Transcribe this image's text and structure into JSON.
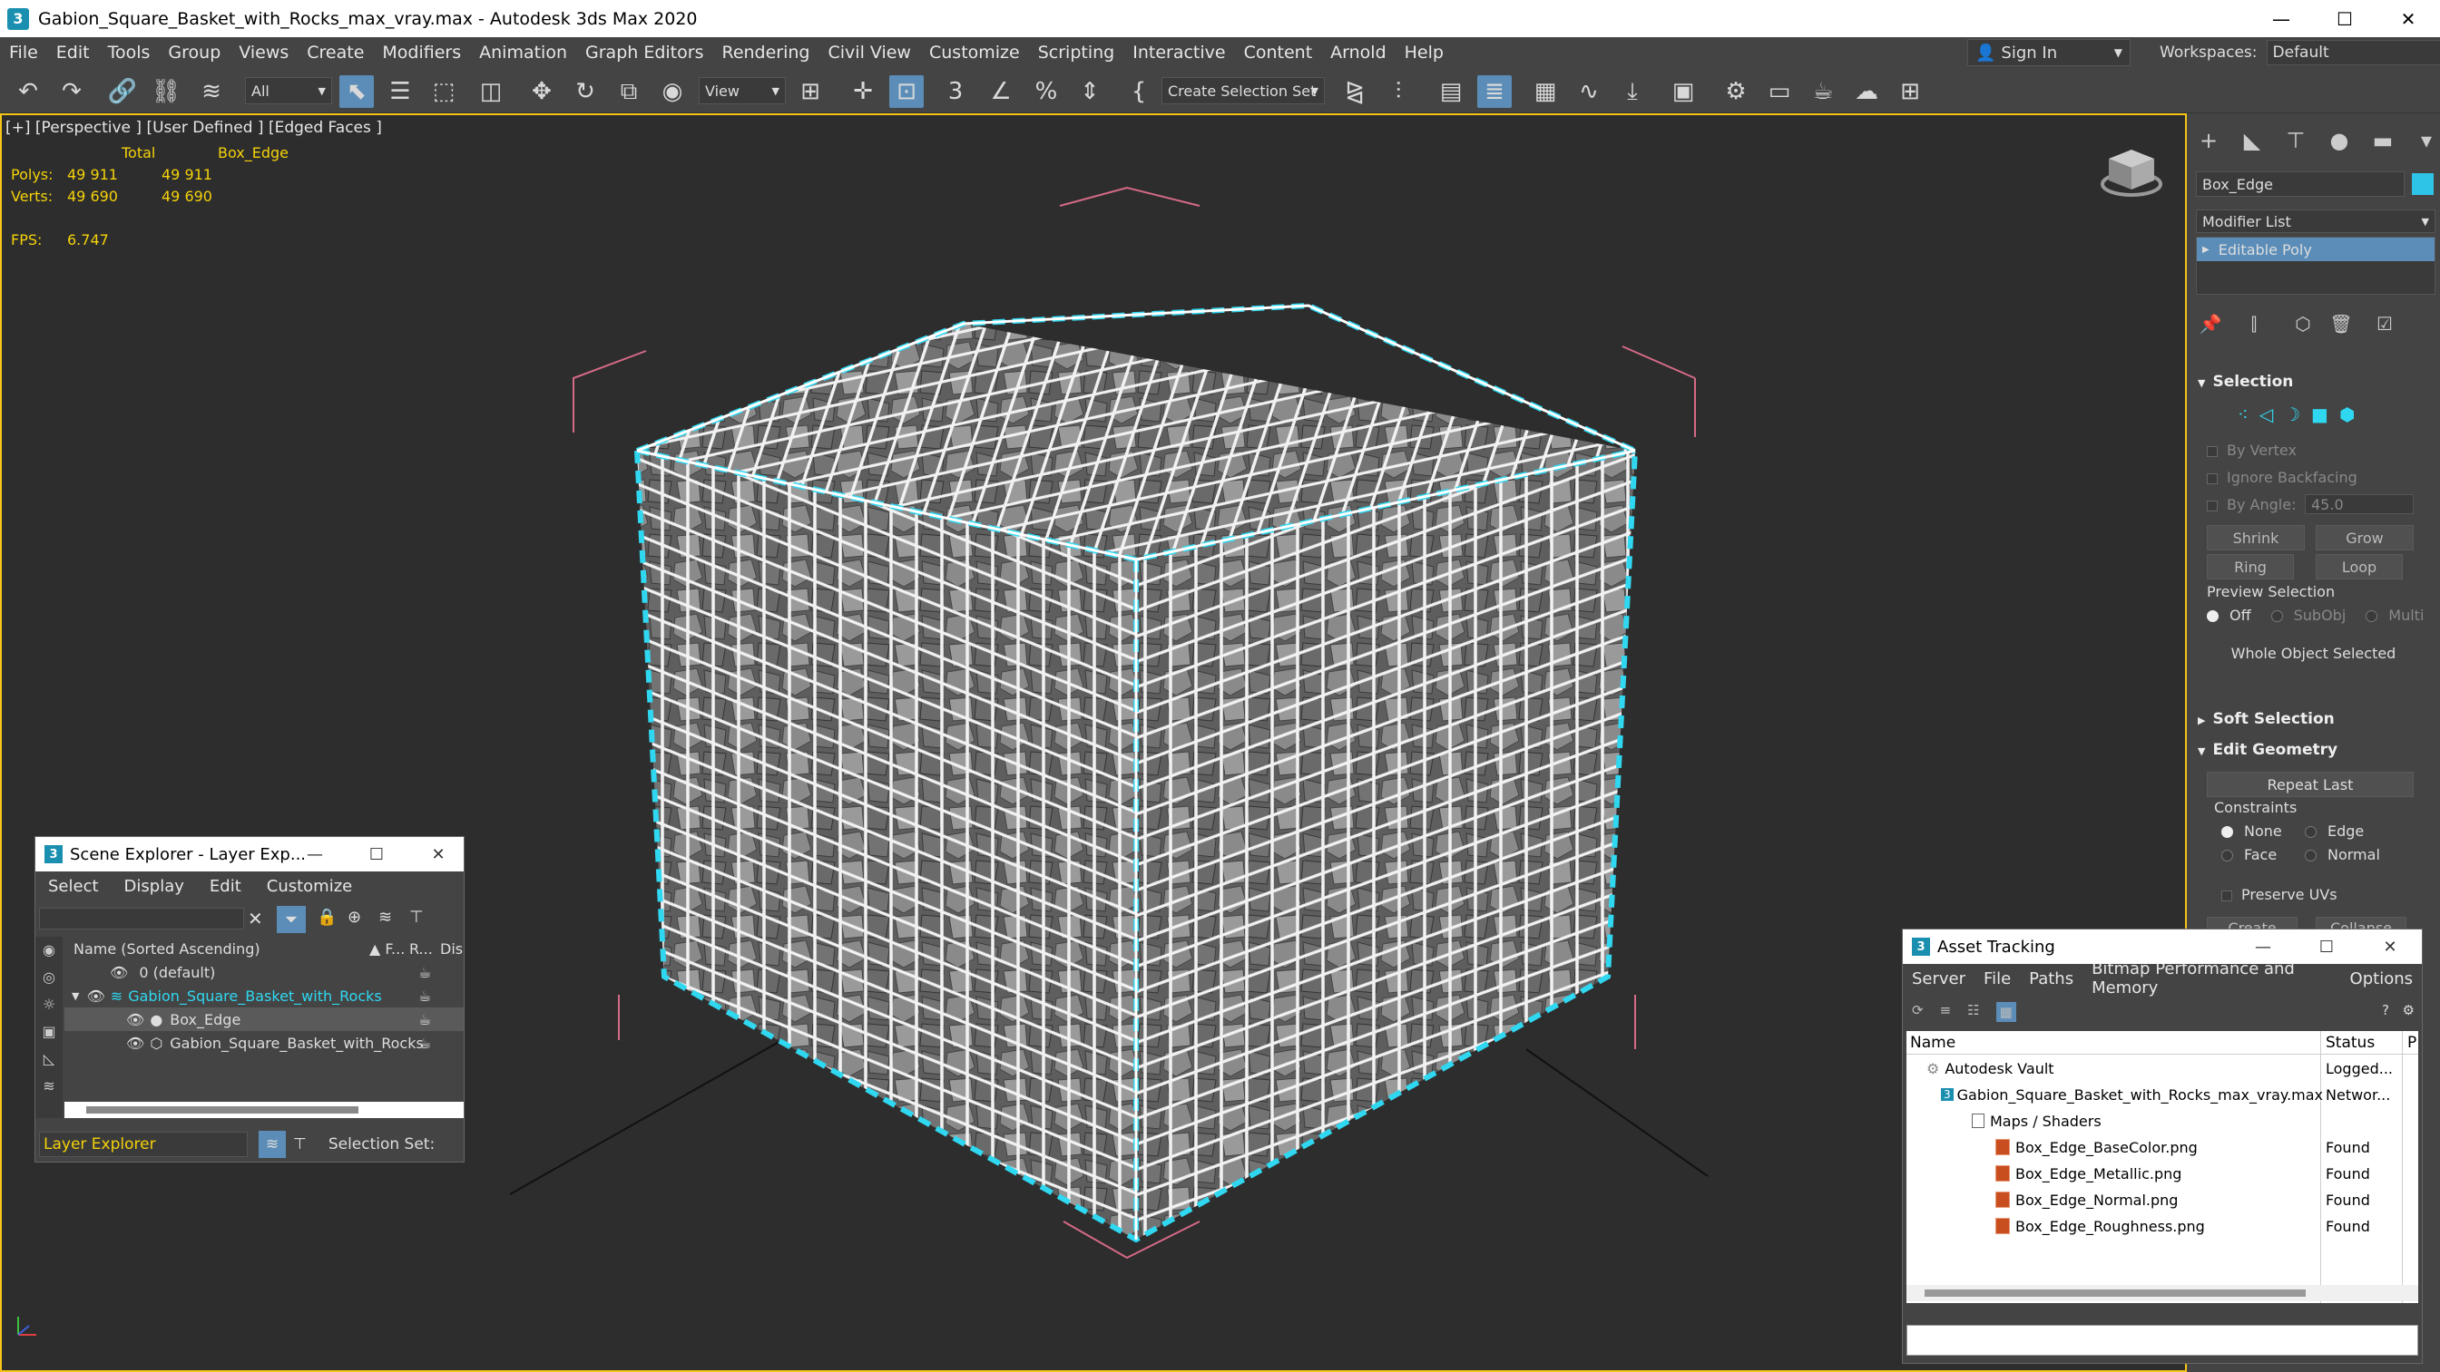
{
  "titlebar": {
    "title": "Gabion_Square_Basket_with_Rocks_max_vray.max - Autodesk 3ds Max 2020",
    "logo": "3",
    "minimize": "—",
    "maximize": "☐",
    "close": "✕"
  },
  "menu": [
    "File",
    "Edit",
    "Tools",
    "Group",
    "Views",
    "Create",
    "Modifiers",
    "Animation",
    "Graph Editors",
    "Rendering",
    "Civil View",
    "Customize",
    "Scripting",
    "Interactive",
    "Content",
    "Arnold",
    "Help"
  ],
  "signin": {
    "label": "Sign In"
  },
  "workspaces": {
    "label": "Workspaces:",
    "value": "Default"
  },
  "toolbar": {
    "filter_value": "All",
    "view_value": "View",
    "selection_set_placeholder": "Create Selection Set",
    "snap_number": "3"
  },
  "viewport": {
    "label": "[+] [Perspective ] [User Defined ] [Edged Faces ]",
    "stats": {
      "col_total": "Total",
      "col_object": "Box_Edge",
      "polys_label": "Polys:",
      "polys_total": "49 911",
      "polys_object": "49 911",
      "verts_label": "Verts:",
      "verts_total": "49 690",
      "verts_object": "49 690"
    },
    "fps_label": "FPS:",
    "fps_value": "6.747"
  },
  "command_panel": {
    "object_name": "Box_Edge",
    "object_color": "#2ec4e8",
    "modifier_list": "Modifier List",
    "stack_item": "Editable Poly",
    "selection": {
      "title": "Selection",
      "by_vertex": "By Vertex",
      "ignore_backfacing": "Ignore Backfacing",
      "by_angle": "By Angle:",
      "angle_value": "45.0",
      "shrink": "Shrink",
      "grow": "Grow",
      "ring": "Ring",
      "loop": "Loop",
      "preview_selection": "Preview Selection",
      "off": "Off",
      "subobj": "SubObj",
      "multi": "Multi",
      "status": "Whole Object Selected"
    },
    "soft_selection": "Soft Selection",
    "edit_geometry": {
      "title": "Edit Geometry",
      "repeat_last": "Repeat Last",
      "constraints": "Constraints",
      "none": "None",
      "edge": "Edge",
      "face": "Face",
      "normal": "Normal",
      "preserve_uvs": "Preserve UVs",
      "create": "Create",
      "collapse": "Collapse"
    }
  },
  "scene_explorer": {
    "title": "Scene Explorer - Layer Exp...",
    "menu": [
      "Select",
      "Display",
      "Edit",
      "Customize"
    ],
    "columns": {
      "name": "Name (Sorted Ascending)",
      "frozen": "▲ F...",
      "render": "R...",
      "display": "Dis"
    },
    "rows": [
      {
        "label": "0 (default)"
      },
      {
        "label": "Gabion_Square_Basket_with_Rocks"
      },
      {
        "label": "Box_Edge"
      },
      {
        "label": "Gabion_Square_Basket_with_Rocks"
      }
    ],
    "footer_layer": "Layer Explorer",
    "footer_selset": "Selection Set:"
  },
  "asset_tracking": {
    "title": "Asset Tracking",
    "menu": [
      "Server",
      "File",
      "Paths",
      "Bitmap Performance and Memory",
      "Options"
    ],
    "columns": {
      "name": "Name",
      "status": "Status",
      "p": "P"
    },
    "rows": [
      {
        "name": "Autodesk Vault",
        "status": "Logged..."
      },
      {
        "name": "Gabion_Square_Basket_with_Rocks_max_vray.max",
        "status": "Networ..."
      },
      {
        "name": "Maps / Shaders",
        "status": ""
      },
      {
        "name": "Box_Edge_BaseColor.png",
        "status": "Found"
      },
      {
        "name": "Box_Edge_Metallic.png",
        "status": "Found"
      },
      {
        "name": "Box_Edge_Normal.png",
        "status": "Found"
      },
      {
        "name": "Box_Edge_Roughness.png",
        "status": "Found"
      }
    ]
  }
}
